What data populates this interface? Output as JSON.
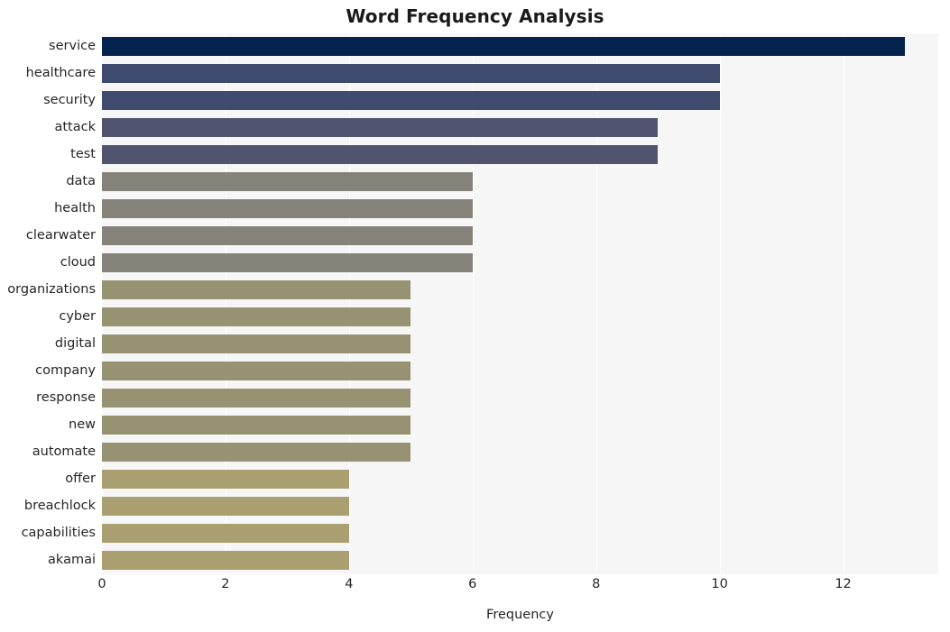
{
  "chart_data": {
    "type": "bar",
    "orientation": "horizontal",
    "title": "Word Frequency Analysis",
    "xlabel": "Frequency",
    "ylabel": "",
    "categories": [
      "service",
      "healthcare",
      "security",
      "attack",
      "test",
      "data",
      "health",
      "clearwater",
      "cloud",
      "organizations",
      "cyber",
      "digital",
      "company",
      "response",
      "new",
      "automate",
      "offer",
      "breachlock",
      "capabilities",
      "akamai"
    ],
    "values": [
      13,
      10,
      10,
      9,
      9,
      6,
      6,
      6,
      6,
      5,
      5,
      5,
      5,
      5,
      5,
      5,
      4,
      4,
      4,
      4
    ],
    "bar_colors": [
      "#04244d",
      "#3e4a6e",
      "#3e4a6e",
      "#50546e",
      "#50546e",
      "#848279",
      "#848279",
      "#848279",
      "#848279",
      "#979272",
      "#979272",
      "#979272",
      "#979272",
      "#979272",
      "#979272",
      "#979272",
      "#aa9f70",
      "#aa9f70",
      "#aa9f70",
      "#aa9f70"
    ],
    "xlim": [
      0,
      13.54
    ],
    "xticks": [
      0,
      2,
      4,
      6,
      8,
      10,
      12
    ],
    "xtick_labels": [
      "0",
      "2",
      "4",
      "6",
      "8",
      "10",
      "12"
    ],
    "grid": true,
    "grid_axis": "x",
    "legend": null,
    "plot_background": "#f6f6f7",
    "figure_background": "#ffffff",
    "title_color": "#1a1a1a",
    "tick_color": "#262626"
  }
}
